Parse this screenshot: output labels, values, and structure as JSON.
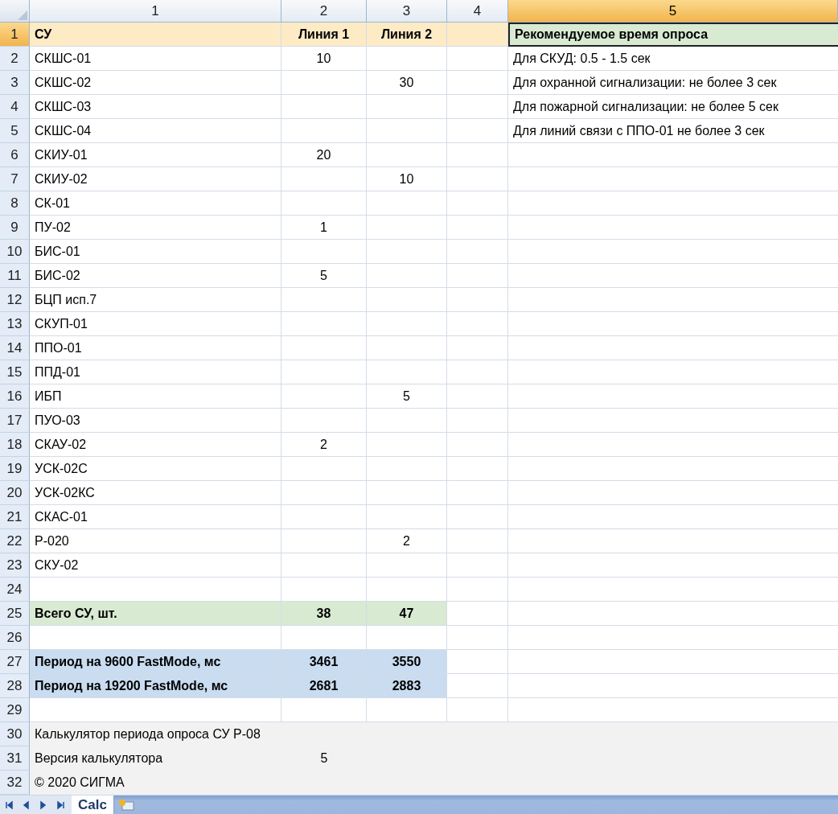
{
  "columns": [
    {
      "label": "1",
      "selected": false
    },
    {
      "label": "2",
      "selected": false
    },
    {
      "label": "3",
      "selected": false
    },
    {
      "label": "4",
      "selected": false
    },
    {
      "label": "5",
      "selected": true
    }
  ],
  "rows": [
    {
      "num": "1",
      "selected": true,
      "kind": "header",
      "column_1": "СУ",
      "column_2": "Линия 1",
      "column_3": "Линия 2",
      "column_5": "Рекомендуемое время опроса"
    },
    {
      "num": "2",
      "selected": false,
      "kind": "plain",
      "column_1": "СКШС-01",
      "column_2": "10",
      "column_5": "Для СКУД: 0.5 - 1.5 сек"
    },
    {
      "num": "3",
      "selected": false,
      "kind": "plain",
      "column_1": "СКШС-02",
      "column_3": "30",
      "column_5": "Для охранной сигнализации: не более 3 сек"
    },
    {
      "num": "4",
      "selected": false,
      "kind": "plain",
      "column_1": "СКШС-03",
      "column_5": "Для пожарной сигнализации: не более 5 сек"
    },
    {
      "num": "5",
      "selected": false,
      "kind": "plain",
      "column_1": "СКШС-04",
      "column_5": "Для линий связи с ППО-01 не более 3 сек"
    },
    {
      "num": "6",
      "selected": false,
      "kind": "plain",
      "column_1": "СКИУ-01",
      "column_2": "20"
    },
    {
      "num": "7",
      "selected": false,
      "kind": "plain",
      "column_1": "СКИУ-02",
      "column_3": "10"
    },
    {
      "num": "8",
      "selected": false,
      "kind": "plain",
      "column_1": "СК-01"
    },
    {
      "num": "9",
      "selected": false,
      "kind": "plain",
      "column_1": "ПУ-02",
      "column_2": "1"
    },
    {
      "num": "10",
      "selected": false,
      "kind": "plain",
      "column_1": "БИС-01"
    },
    {
      "num": "11",
      "selected": false,
      "kind": "plain",
      "column_1": "БИС-02",
      "column_2": "5"
    },
    {
      "num": "12",
      "selected": false,
      "kind": "plain",
      "column_1": "БЦП исп.7"
    },
    {
      "num": "13",
      "selected": false,
      "kind": "plain",
      "column_1": "СКУП-01"
    },
    {
      "num": "14",
      "selected": false,
      "kind": "plain",
      "column_1": "ППО-01"
    },
    {
      "num": "15",
      "selected": false,
      "kind": "plain",
      "column_1": "ППД-01"
    },
    {
      "num": "16",
      "selected": false,
      "kind": "plain",
      "column_1": "ИБП",
      "column_3": "5"
    },
    {
      "num": "17",
      "selected": false,
      "kind": "plain",
      "column_1": "ПУО-03"
    },
    {
      "num": "18",
      "selected": false,
      "kind": "plain",
      "column_1": "СКАУ-02",
      "column_2": "2"
    },
    {
      "num": "19",
      "selected": false,
      "kind": "plain",
      "column_1": "УСК-02С"
    },
    {
      "num": "20",
      "selected": false,
      "kind": "plain",
      "column_1": "УСК-02КС"
    },
    {
      "num": "21",
      "selected": false,
      "kind": "plain",
      "column_1": "СКАС-01"
    },
    {
      "num": "22",
      "selected": false,
      "kind": "plain",
      "column_1": "Р-020",
      "column_3": "2"
    },
    {
      "num": "23",
      "selected": false,
      "kind": "plain",
      "column_1": "СКУ-02"
    },
    {
      "num": "24",
      "selected": false,
      "kind": "plain"
    },
    {
      "num": "25",
      "selected": false,
      "kind": "total",
      "column_1": "Всего СУ, шт.",
      "column_2": "38",
      "column_3": "47"
    },
    {
      "num": "26",
      "selected": false,
      "kind": "plain"
    },
    {
      "num": "27",
      "selected": false,
      "kind": "period",
      "column_1": "Период на 9600 FastMode, мс",
      "column_2": "3461",
      "column_3": "3550"
    },
    {
      "num": "28",
      "selected": false,
      "kind": "period",
      "column_1": "Период на 19200 FastMode, мс",
      "column_2": "2681",
      "column_3": "2883"
    },
    {
      "num": "29",
      "selected": false,
      "kind": "plain"
    },
    {
      "num": "30",
      "selected": false,
      "kind": "footer",
      "column_1": "Калькулятор периода опроса СУ Р-08"
    },
    {
      "num": "31",
      "selected": false,
      "kind": "footer",
      "column_1": "Версия калькулятора",
      "column_2": "5"
    },
    {
      "num": "32",
      "selected": false,
      "kind": "footer",
      "column_1": "© 2020 СИГМА"
    }
  ],
  "sheet_tabs": [
    {
      "label": "Calc",
      "selected": true
    }
  ]
}
